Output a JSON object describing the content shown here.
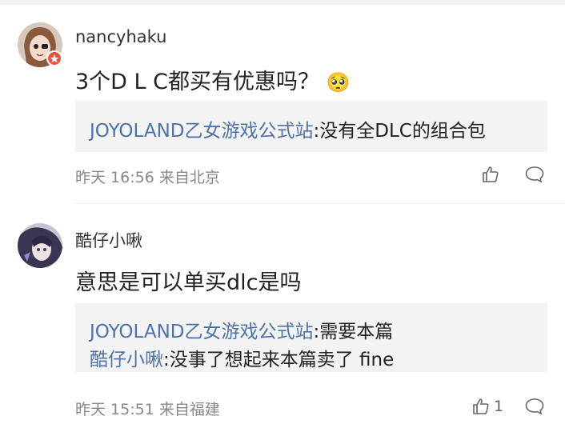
{
  "comments": [
    {
      "username": "nancyhaku",
      "text": "3个D L C都买有优惠吗？",
      "emoji": "🥺",
      "replies": [
        {
          "name": "JOYOLAND乙女游戏公式站",
          "text": ":没有全DLC的组合包"
        }
      ],
      "time": "昨天 16:56 来自北京",
      "likes": ""
    },
    {
      "username": "酷仔小啾",
      "text": "意思是可以单买dlc是吗",
      "emoji": "",
      "replies": [
        {
          "name": "JOYOLAND乙女游戏公式站",
          "text": ":需要本篇"
        },
        {
          "name": "酷仔小啾",
          "text": ":没事了想起来本篇卖了 fine"
        }
      ],
      "time": "昨天 15:51 来自福建",
      "likes": "1"
    }
  ],
  "icons": {
    "like": "thumbs-up-icon",
    "comment": "comment-bubble-icon"
  },
  "colors": {
    "accent": "#4c72a8",
    "badge": "#f0503a",
    "reply_bg": "#f3f3f3"
  }
}
